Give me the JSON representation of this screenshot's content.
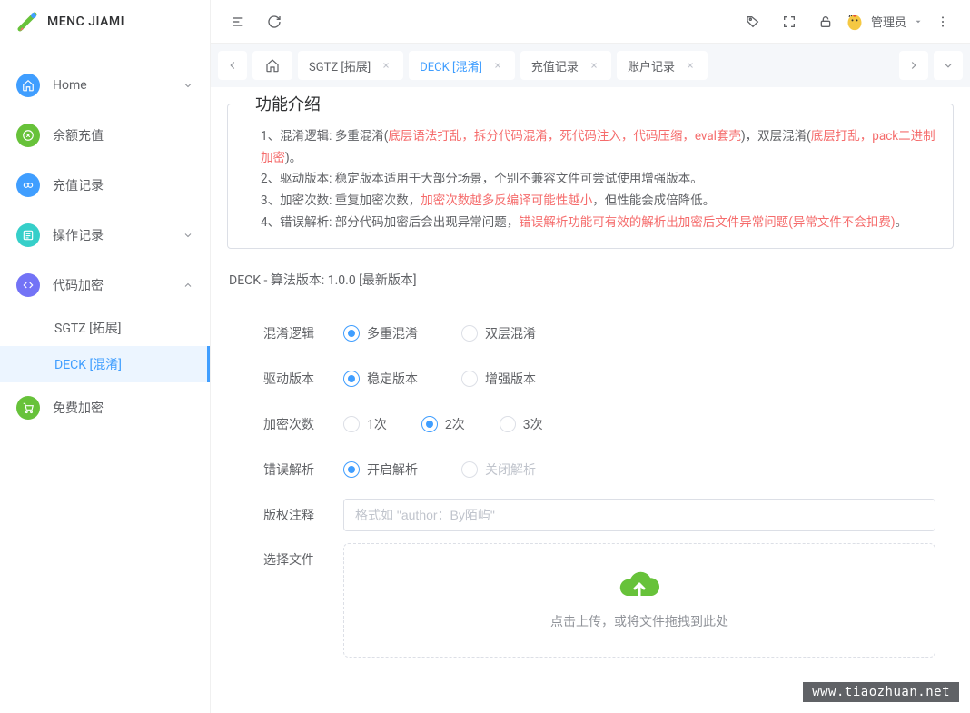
{
  "app": {
    "title": "MENC JIAMI"
  },
  "user": {
    "name": "管理员"
  },
  "sidebar": {
    "items": [
      {
        "label": "Home"
      },
      {
        "label": "余额充值"
      },
      {
        "label": "充值记录"
      },
      {
        "label": "操作记录"
      },
      {
        "label": "代码加密"
      },
      {
        "label": "免费加密"
      }
    ],
    "sub_code": [
      {
        "label": "SGTZ [拓展]"
      },
      {
        "label": "DECK [混淆]"
      }
    ]
  },
  "tabs": [
    {
      "label": "SGTZ [拓展]"
    },
    {
      "label": "DECK [混淆]"
    },
    {
      "label": "充值记录"
    },
    {
      "label": "账户记录"
    }
  ],
  "intro": {
    "title": "功能介绍",
    "l1a": "1、混淆逻辑: 多重混淆(",
    "l1b": "底层语法打乱，拆分代码混淆，死代码注入，代码压缩，eval套壳",
    "l1c": ")，双层混淆(",
    "l1d": "底层打乱，pack二进制加密",
    "l1e": ")。",
    "l2": "2、驱动版本: 稳定版本适用于大部分场景，个别不兼容文件可尝试使用增强版本。",
    "l3a": "3、加密次数: 重复加密次数，",
    "l3b": "加密次数越多反编译可能性越小",
    "l3c": "，但性能会成倍降低。",
    "l4a": "4、错误解析: 部分代码加密后会出现异常问题，",
    "l4b": "错误解析功能可有效的解析出加密后文件异常问题(异常文件不会扣费)",
    "l4c": "。"
  },
  "version": "DECK - 算法版本: 1.0.0 [最新版本]",
  "form": {
    "logic": {
      "label": "混淆逻辑",
      "opts": [
        "多重混淆",
        "双层混淆"
      ]
    },
    "driver": {
      "label": "驱动版本",
      "opts": [
        "稳定版本",
        "增强版本"
      ]
    },
    "times": {
      "label": "加密次数",
      "opts": [
        "1次",
        "2次",
        "3次"
      ]
    },
    "error": {
      "label": "错误解析",
      "opts": [
        "开启解析",
        "关闭解析"
      ]
    },
    "copyright": {
      "label": "版权注释",
      "placeholder": "格式如 \"author：By陌屿\""
    },
    "file": {
      "label": "选择文件",
      "hint": "点击上传，或将文件拖拽到此处"
    }
  },
  "watermark": "www.tiaozhuan.net"
}
